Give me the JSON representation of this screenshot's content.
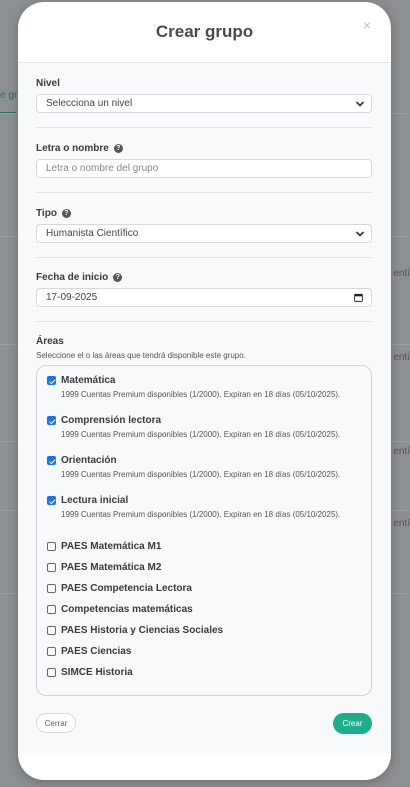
{
  "modal": {
    "title": "Crear grupo",
    "close_symbol": "×"
  },
  "form": {
    "nivel": {
      "label": "Nivel",
      "selected": "Selecciona un nivel"
    },
    "letra": {
      "label": "Letra o nombre",
      "placeholder": "Letra o nombre del grupo",
      "help_icon": "question-circle-icon"
    },
    "tipo": {
      "label": "Tipo",
      "selected": "Humanista Científico",
      "help_icon": "question-circle-icon"
    },
    "fecha": {
      "label": "Fecha de inicio",
      "value": "17-09-2025",
      "help_icon": "question-circle-icon"
    }
  },
  "areas": {
    "title": "Áreas",
    "help": "Seleccione el o las áreas que tendrá disponible este grupo.",
    "items": [
      {
        "name": "Matemática",
        "checked": true,
        "desc": "1999 Cuentas Premium disponibles (1/2000). Expiran en 18 días (05/10/2025)."
      },
      {
        "name": "Comprensión lectora",
        "checked": true,
        "desc": "1999 Cuentas Premium disponibles (1/2000). Expiran en 18 días (05/10/2025)."
      },
      {
        "name": "Orientación",
        "checked": true,
        "desc": "1999 Cuentas Premium disponibles (1/2000). Expiran en 18 días (05/10/2025)."
      },
      {
        "name": "Lectura inicial",
        "checked": true,
        "desc": "1999 Cuentas Premium disponibles (1/2000). Expiran en 18 días (05/10/2025)."
      },
      {
        "name": "PAES Matemática M1",
        "checked": false,
        "desc": ""
      },
      {
        "name": "PAES Matemática M2",
        "checked": false,
        "desc": ""
      },
      {
        "name": "PAES Competencia Lectora",
        "checked": false,
        "desc": ""
      },
      {
        "name": "Competencias matemáticas",
        "checked": false,
        "desc": ""
      },
      {
        "name": "PAES Historia y Ciencias Sociales",
        "checked": false,
        "desc": ""
      },
      {
        "name": "PAES Ciencias",
        "checked": false,
        "desc": ""
      },
      {
        "name": "SIMCE Historia",
        "checked": false,
        "desc": ""
      }
    ]
  },
  "buttons": {
    "close": "Cerrar",
    "create": "Crear"
  },
  "background": {
    "tab_text": "e gr",
    "side_text": "entí"
  },
  "colors": {
    "accent": "#1fae8c",
    "checkbox": "#1a73e8",
    "overlay": "#8d9092"
  }
}
